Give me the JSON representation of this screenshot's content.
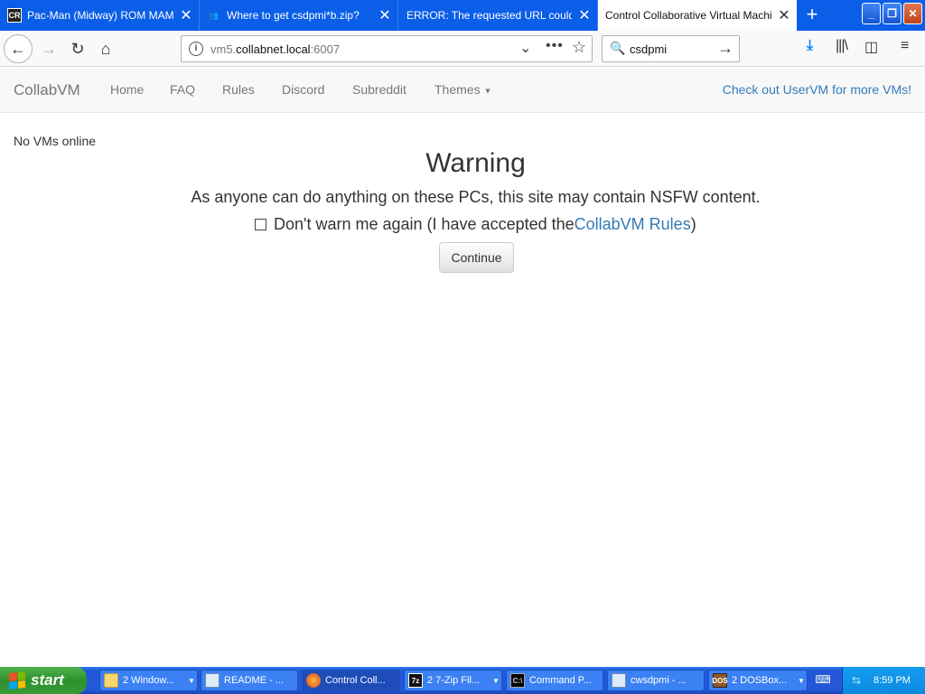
{
  "browser": {
    "tabs": [
      {
        "title": "Pac-Man (Midway) ROM MAME - E",
        "favicon": "cr-favicon",
        "favicon_text": "CR",
        "active": false
      },
      {
        "title": "Where to get csdpmi*b.zip?",
        "favicon": "people-icon",
        "active": false
      },
      {
        "title": "ERROR: The requested URL could not",
        "favicon": "",
        "active": false
      },
      {
        "title": "Control Collaborative Virtual Machines",
        "favicon": "",
        "active": true
      }
    ],
    "new_tab": "+",
    "window_buttons": {
      "minimize": "_",
      "restore": "❐",
      "close": "✕"
    },
    "url": {
      "prefix": "vm5.",
      "host": "collabnet.local",
      "port": ":6007"
    },
    "search_text": "csdpmi"
  },
  "site": {
    "brand": "CollabVM",
    "nav": [
      {
        "label": "Home"
      },
      {
        "label": "FAQ"
      },
      {
        "label": "Rules"
      },
      {
        "label": "Discord"
      },
      {
        "label": "Subreddit"
      },
      {
        "label": "Themes"
      }
    ],
    "uservm_link": "Check out UserVM for more VMs!"
  },
  "main": {
    "vm_status": "No VMs online",
    "warning_title": "Warning",
    "warning_text": "As anyone can do anything on these PCs, this site may contain NSFW content.",
    "dontwarn_prefix": "Don't warn me again (I have accepted the ",
    "rules_link": "CollabVM Rules",
    "dontwarn_suffix": ")",
    "continue_label": "Continue"
  },
  "taskbar": {
    "start_label": "start",
    "tasks": [
      {
        "label": "2 Window...",
        "icon": "folder-icon",
        "grouped": true
      },
      {
        "label": "README - ...",
        "icon": "notepad-icon",
        "grouped": false
      },
      {
        "label": "Control Coll...",
        "icon": "firefox-icon",
        "grouped": false,
        "active": true
      },
      {
        "label": "2 7-Zip Fil...",
        "icon": "7zip-icon",
        "icon_text": "7z",
        "grouped": true
      },
      {
        "label": "Command P...",
        "icon": "cmd-icon",
        "icon_text": "C:\\",
        "grouped": false
      },
      {
        "label": "cwsdpmi - ...",
        "icon": "notepad-icon",
        "grouped": false
      },
      {
        "label": "2 DOSBox...",
        "icon": "dosbox-icon",
        "icon_text": "DOS",
        "grouped": true
      }
    ],
    "clock": "8:59 PM"
  },
  "colors": {
    "titlebar": "#0a5ee8",
    "link": "#337ab7",
    "taskbar": "#2458d9",
    "start": "#3a9c38"
  }
}
